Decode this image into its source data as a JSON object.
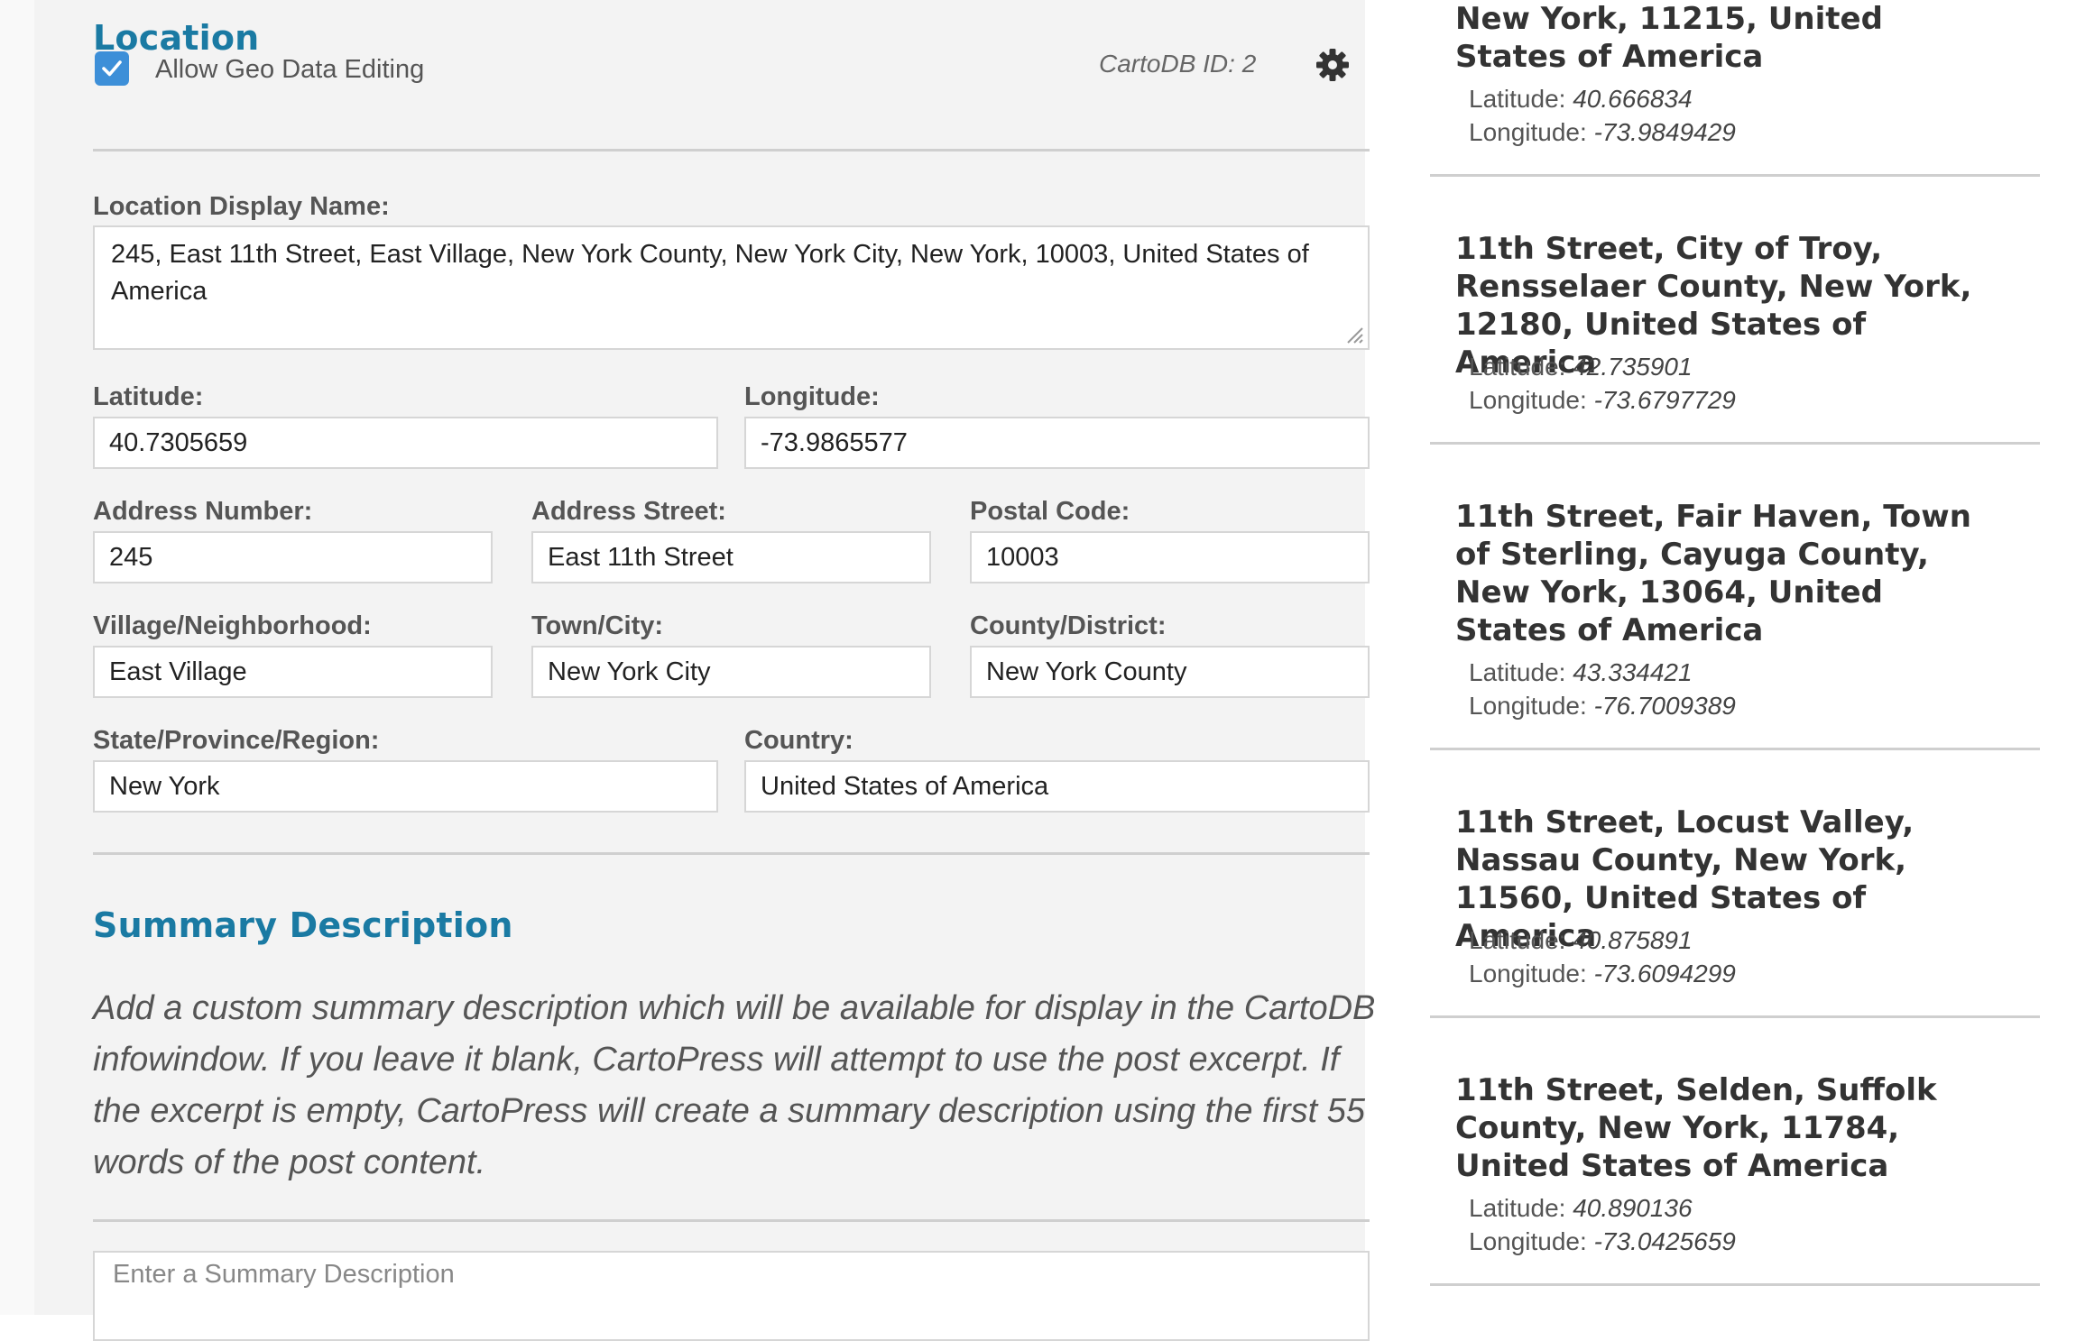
{
  "location": {
    "title": "Location",
    "allow_geo_label": "Allow Geo Data Editing",
    "allow_geo_checked": true,
    "cartodb_id": "CartoDB ID: 2",
    "display_name_label": "Location Display Name:",
    "display_name_value": "245, East 11th Street, East Village, New York County, New York City, New York, 10003, United States of America",
    "latitude_label": "Latitude:",
    "latitude_value": "40.7305659",
    "longitude_label": "Longitude:",
    "longitude_value": "-73.9865577",
    "address_number_label": "Address Number:",
    "address_number_value": "245",
    "address_street_label": "Address Street:",
    "address_street_value": "East 11th Street",
    "postal_code_label": "Postal Code:",
    "postal_code_value": "10003",
    "village_label": "Village/Neighborhood:",
    "village_value": "East Village",
    "town_label": "Town/City:",
    "town_value": "New York City",
    "county_label": "County/District:",
    "county_value": "New York County",
    "state_label": "State/Province/Region:",
    "state_value": "New York",
    "country_label": "Country:",
    "country_value": "United States of America"
  },
  "summary": {
    "title": "Summary Description",
    "description": "Add a custom summary description which will be available for display in the CartoDB infowindow. If you leave it blank, CartoPress will attempt to use the post excerpt. If the excerpt is empty, CartoPress will create a summary description using the first 55 words of the post content.",
    "placeholder": "Enter a Summary Description"
  },
  "results": {
    "latitude_key": "Latitude:",
    "longitude_key": "Longitude:",
    "items": [
      {
        "title": "New York, 11215, United States of America",
        "lat": "40.666834",
        "lng": "-73.9849429"
      },
      {
        "title": "11th Street, City of Troy, Rensselaer County, New York, 12180, United States of America",
        "lat": "42.735901",
        "lng": "-73.6797729"
      },
      {
        "title": "11th Street, Fair Haven, Town of Sterling, Cayuga County, New York, 13064, United States of America",
        "lat": "43.334421",
        "lng": "-76.7009389"
      },
      {
        "title": "11th Street, Locust Valley, Nassau County, New York, 11560, United States of America",
        "lat": "40.875891",
        "lng": "-73.6094299"
      },
      {
        "title": "11th Street, Selden, Suffolk County, New York, 11784, United States of America",
        "lat": "40.890136",
        "lng": "-73.0425659"
      }
    ]
  },
  "colors": {
    "accent": "#1a7aa3",
    "checkbox": "#3d8fd8",
    "panel_bg": "#f3f3f3"
  },
  "icons": {
    "settings": "gear-icon",
    "checkbox": "check-icon",
    "resize": "resize-handle-icon"
  }
}
